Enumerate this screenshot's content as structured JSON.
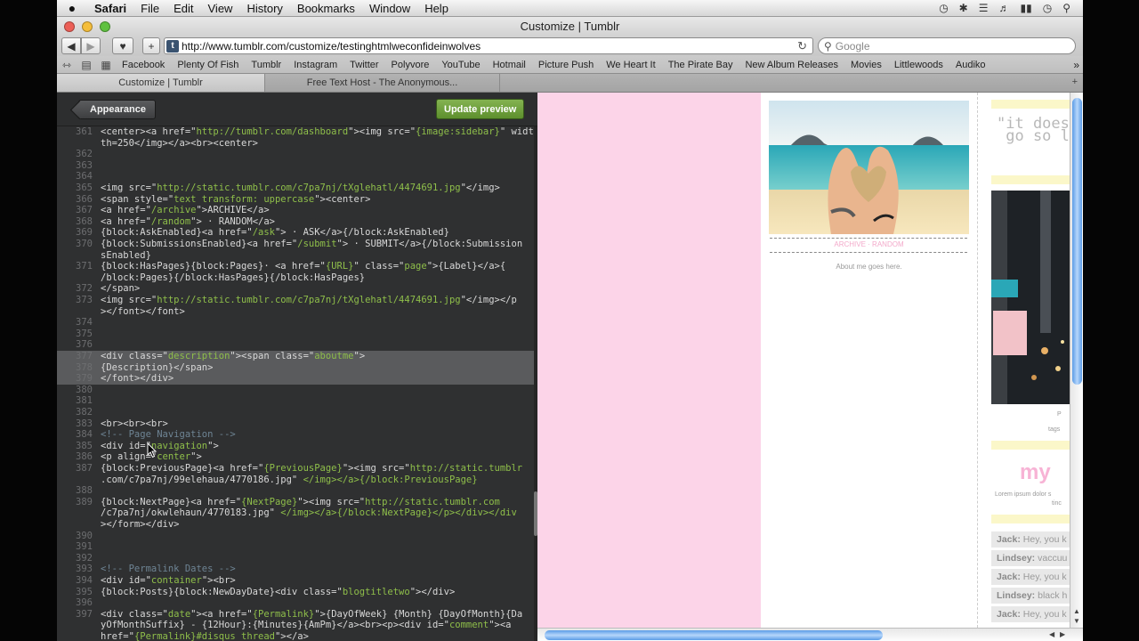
{
  "menubar": {
    "apple": "",
    "app": "Safari",
    "items": [
      "File",
      "Edit",
      "View",
      "History",
      "Bookmarks",
      "Window",
      "Help"
    ]
  },
  "window": {
    "title": "Customize | Tumblr"
  },
  "toolbar": {
    "url": "http://www.tumblr.com/customize/testinghtmlweconfideinwolves",
    "search_placeholder": "Google",
    "fav_letter": "t"
  },
  "bookmarks": [
    "Facebook",
    "Plenty Of Fish",
    "Tumblr",
    "Instagram",
    "Twitter",
    "Polyvore",
    "YouTube",
    "Hotmail",
    "Picture Push",
    "We Heart It",
    "The Pirate Bay",
    "New Album Releases",
    "Movies",
    "Littlewoods",
    "Audiko"
  ],
  "tabs": [
    {
      "label": "Customize | Tumblr"
    },
    {
      "label": "Free Text Host - The Anonymous..."
    }
  ],
  "editor": {
    "appearance_label": "Appearance",
    "update_label": "Update preview",
    "lines": [
      {
        "n": "361",
        "t": "<center><a href=\"http://tumblr.com/dashboard\"><img src=\"{image:sidebar}\" width"
      },
      {
        "n": "",
        "t": "th=250</img></a><br><center>"
      },
      {
        "n": "362",
        "t": ""
      },
      {
        "n": "363",
        "t": ""
      },
      {
        "n": "364",
        "t": ""
      },
      {
        "n": "365",
        "t": "<img src=\"http://static.tumblr.com/c7pa7nj/tXglehatl/4474691.jpg\"</img>"
      },
      {
        "n": "366",
        "t": "<span style=\"text transform: uppercase\"><center>"
      },
      {
        "n": "367",
        "t": "<a href=\"/archive\">ARCHIVE</a>"
      },
      {
        "n": "368",
        "t": "<a href=\"/random\"> · RANDOM</a>"
      },
      {
        "n": "369",
        "t": "{block:AskEnabled}<a href=\"/ask\"> · ASK</a>{/block:AskEnabled}"
      },
      {
        "n": "370",
        "t": "{block:SubmissionsEnabled}<a href=\"/submit\"> · SUBMIT</a>{/block:Submission"
      },
      {
        "n": "",
        "t": "sEnabled}"
      },
      {
        "n": "371",
        "t": "{block:HasPages}{block:Pages}· <a href=\"{URL}\" class=\"page\">{Label}</a>{"
      },
      {
        "n": "",
        "t": "/block:Pages}{/block:HasPages}{/block:HasPages}"
      },
      {
        "n": "372",
        "t": "</span>"
      },
      {
        "n": "373",
        "t": "<img src=\"http://static.tumblr.com/c7pa7nj/tXglehatl/4474691.jpg\"</img></p"
      },
      {
        "n": "",
        "t": "></font></font>"
      },
      {
        "n": "374",
        "t": ""
      },
      {
        "n": "375",
        "t": ""
      },
      {
        "n": "376",
        "t": ""
      },
      {
        "n": "377",
        "t": "<div class=\"description\"><span class=\"aboutme\">"
      },
      {
        "n": "378",
        "t": "{Description}</span>"
      },
      {
        "n": "379",
        "t": "</font></div>"
      },
      {
        "n": "380",
        "t": ""
      },
      {
        "n": "381",
        "t": ""
      },
      {
        "n": "382",
        "t": ""
      },
      {
        "n": "383",
        "t": "<br><br><br>"
      },
      {
        "n": "384",
        "t": "<!-- Page Navigation -->"
      },
      {
        "n": "385",
        "t": "<div id=\"navigation\">"
      },
      {
        "n": "386",
        "t": "<p align=\"center\">"
      },
      {
        "n": "387",
        "t": "{block:PreviousPage}<a href=\"{PreviousPage}\"><img src=\"http://static.tumblr"
      },
      {
        "n": "",
        "t": ".com/c7pa7nj/99elehaua/4770186.jpg\" </img></a>{/block:PreviousPage}"
      },
      {
        "n": "388",
        "t": ""
      },
      {
        "n": "389",
        "t": "{block:NextPage}<a href=\"{NextPage}\"><img src=\"http://static.tumblr.com"
      },
      {
        "n": "",
        "t": "/c7pa7nj/okwlehaun/4770183.jpg\" </img></a>{/block:NextPage}</p></div></div"
      },
      {
        "n": "",
        "t": "></form></div>"
      },
      {
        "n": "390",
        "t": ""
      },
      {
        "n": "391",
        "t": ""
      },
      {
        "n": "392",
        "t": ""
      },
      {
        "n": "393",
        "t": "<!-- Permalink Dates -->"
      },
      {
        "n": "394",
        "t": "<div id=\"container\"><br>"
      },
      {
        "n": "395",
        "t": "{block:Posts}{block:NewDayDate}<div class=\"blogtitletwo\"></div>"
      },
      {
        "n": "396",
        "t": ""
      },
      {
        "n": "397",
        "t": "<div class=\"date\"><a href=\"{Permalink}\">{DayOfWeek} {Month} {DayOfMonth}{Da"
      },
      {
        "n": "",
        "t": "yOfMonthSuffix} - {12Hour}:{Minutes}{AmPm}</a><br><p><div id=\"comment\"><a"
      },
      {
        "n": "",
        "t": "href=\"{Permalink}#disqus_thread\"></a>"
      }
    ]
  },
  "preview": {
    "archive_links": "ARCHIVE · RANDOM",
    "about_me": "About me goes here.",
    "quote_line1": "\"it does",
    "quote_line2": " go so l",
    "side_text_1": "P",
    "side_text_2": "tags",
    "my_title": "my",
    "lorem_1": "Lorem ipsum dolor s",
    "lorem_2": "tinc",
    "chats": [
      {
        "name": "Jack:",
        "text": " Hey, you k"
      },
      {
        "name": "Lindsey:",
        "text": " vaccuu"
      },
      {
        "name": "Jack:",
        "text": " Hey, you k"
      },
      {
        "name": "Lindsey:",
        "text": " black h"
      },
      {
        "name": "Jack:",
        "text": " Hey, you k"
      }
    ]
  },
  "colors": {
    "editor_bg": "#2f3031",
    "string_green": "#8fbf4a",
    "preview_pink": "#fcd4e8",
    "update_green": "#6fa23c"
  }
}
